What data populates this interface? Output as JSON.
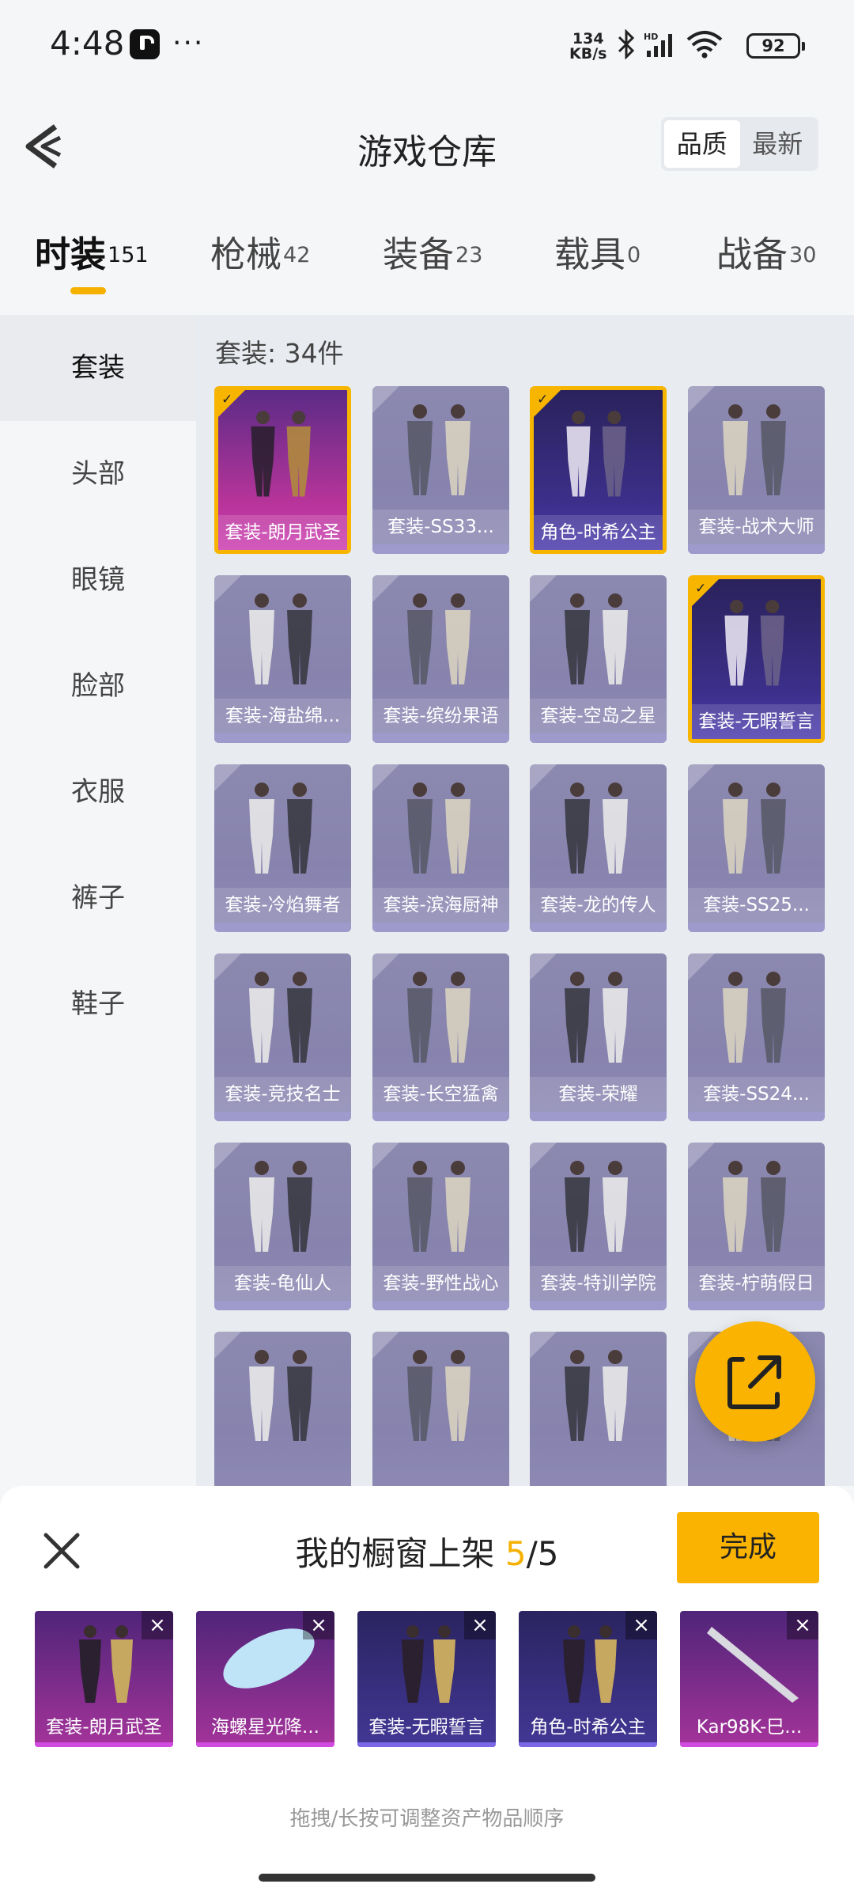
{
  "status": {
    "time": "4:48",
    "more": "···",
    "speed_value": "134",
    "speed_unit": "KB/s",
    "battery": "92"
  },
  "header": {
    "title": "游戏仓库",
    "sort_options": [
      "品质",
      "最新"
    ]
  },
  "tabs": [
    {
      "label": "时装",
      "count": "151"
    },
    {
      "label": "枪械",
      "count": "42"
    },
    {
      "label": "装备",
      "count": "23"
    },
    {
      "label": "载具",
      "count": "0"
    },
    {
      "label": "战备",
      "count": "30"
    }
  ],
  "sidebar": {
    "items": [
      "套装",
      "头部",
      "眼镜",
      "脸部",
      "衣服",
      "裤子",
      "鞋子"
    ]
  },
  "grid": {
    "count_label": "套装: 34件",
    "items": [
      {
        "name": "套装-朗月武圣",
        "selected": true,
        "style": "purple"
      },
      {
        "name": "套装-SS33...",
        "selected": false,
        "style": "grey"
      },
      {
        "name": "角色-时希公主",
        "selected": true,
        "style": "navy"
      },
      {
        "name": "套装-战术大师",
        "selected": false,
        "style": "grey"
      },
      {
        "name": "套装-海盐绵...",
        "selected": false,
        "style": "grey"
      },
      {
        "name": "套装-缤纷果语",
        "selected": false,
        "style": "grey"
      },
      {
        "name": "套装-空岛之星",
        "selected": false,
        "style": "grey"
      },
      {
        "name": "套装-无暇誓言",
        "selected": true,
        "style": "navy"
      },
      {
        "name": "套装-冷焰舞者",
        "selected": false,
        "style": "grey"
      },
      {
        "name": "套装-滨海厨神",
        "selected": false,
        "style": "grey"
      },
      {
        "name": "套装-龙的传人",
        "selected": false,
        "style": "grey"
      },
      {
        "name": "套装-SS25...",
        "selected": false,
        "style": "grey"
      },
      {
        "name": "套装-竞技名士",
        "selected": false,
        "style": "grey"
      },
      {
        "name": "套装-长空猛禽",
        "selected": false,
        "style": "grey"
      },
      {
        "name": "套装-荣耀",
        "selected": false,
        "style": "grey"
      },
      {
        "name": "套装-SS24...",
        "selected": false,
        "style": "grey"
      },
      {
        "name": "套装-龟仙人",
        "selected": false,
        "style": "grey"
      },
      {
        "name": "套装-野性战心",
        "selected": false,
        "style": "grey"
      },
      {
        "name": "套装-特训学院",
        "selected": false,
        "style": "grey"
      },
      {
        "name": "套装-柠萌假日",
        "selected": false,
        "style": "grey"
      },
      {
        "name": "",
        "selected": false,
        "style": "grey"
      },
      {
        "name": "",
        "selected": false,
        "style": "grey"
      },
      {
        "name": "",
        "selected": false,
        "style": "grey"
      },
      {
        "name": "",
        "selected": false,
        "style": "grey"
      }
    ]
  },
  "sheet": {
    "title": "我的橱窗上架",
    "current": "5",
    "total": "/5",
    "done_label": "完成",
    "items": [
      {
        "name": "套装-朗月武圣",
        "style": "purple"
      },
      {
        "name": "海螺星光降...",
        "style": "purple"
      },
      {
        "name": "套装-无暇誓言",
        "style": "navy"
      },
      {
        "name": "角色-时希公主",
        "style": "navy"
      },
      {
        "name": "Kar98K-巳...",
        "style": "purple"
      }
    ],
    "hint": "拖拽/长按可调整资产物品顺序"
  },
  "colors": {
    "accent": "#f9b300",
    "page_bg": "#f5f6f8",
    "tile_grey": "#8c89b0"
  }
}
